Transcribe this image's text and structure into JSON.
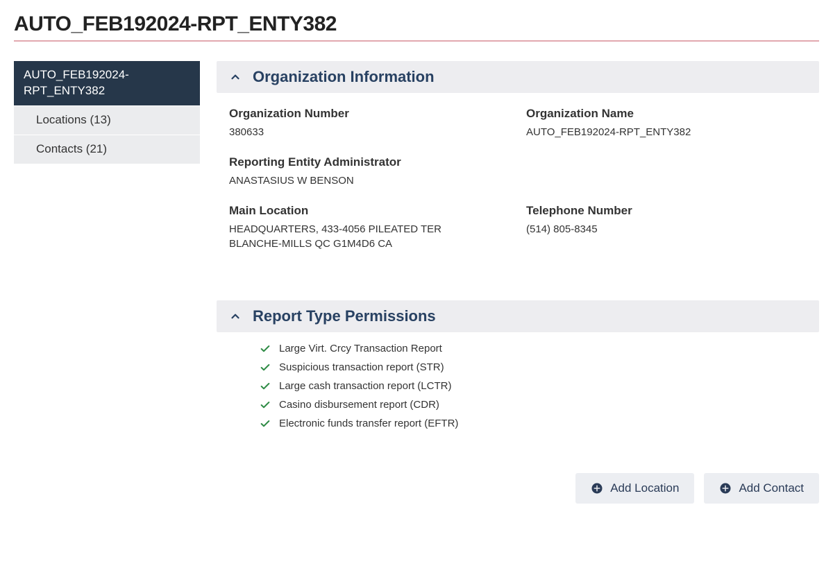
{
  "page_title": "AUTO_FEB192024-RPT_ENTY382",
  "sidebar": {
    "items": [
      {
        "label": "AUTO_FEB192024-\nRPT_ENTY382",
        "active": true
      },
      {
        "label": "Locations (13)",
        "sub": true
      },
      {
        "label": "Contacts (21)",
        "sub": true
      }
    ]
  },
  "org_panel": {
    "title": "Organization Information",
    "fields": {
      "org_number_label": "Organization Number",
      "org_number_value": "380633",
      "org_name_label": "Organization Name",
      "org_name_value": "AUTO_FEB192024-RPT_ENTY382",
      "admin_label": "Reporting Entity Administrator",
      "admin_value": "ANASTASIUS W BENSON",
      "main_loc_label": "Main Location",
      "main_loc_value": "HEADQUARTERS, 433-4056 PILEATED TER BLANCHE-MILLS QC G1M4D6 CA",
      "tel_label": "Telephone Number",
      "tel_value": "(514) 805-8345"
    }
  },
  "perm_panel": {
    "title": "Report Type Permissions",
    "items": [
      "Large Virt. Crcy Transaction Report",
      "Suspicious transaction report (STR)",
      "Large cash transaction report (LCTR)",
      "Casino disbursement report (CDR)",
      "Electronic funds transfer report (EFTR)"
    ]
  },
  "actions": {
    "add_location_label": "Add Location",
    "add_contact_label": "Add Contact"
  },
  "icons": {
    "chevron_up": "chevron-up-icon",
    "checkmark": "check-icon",
    "plus": "plus-circle-icon"
  }
}
